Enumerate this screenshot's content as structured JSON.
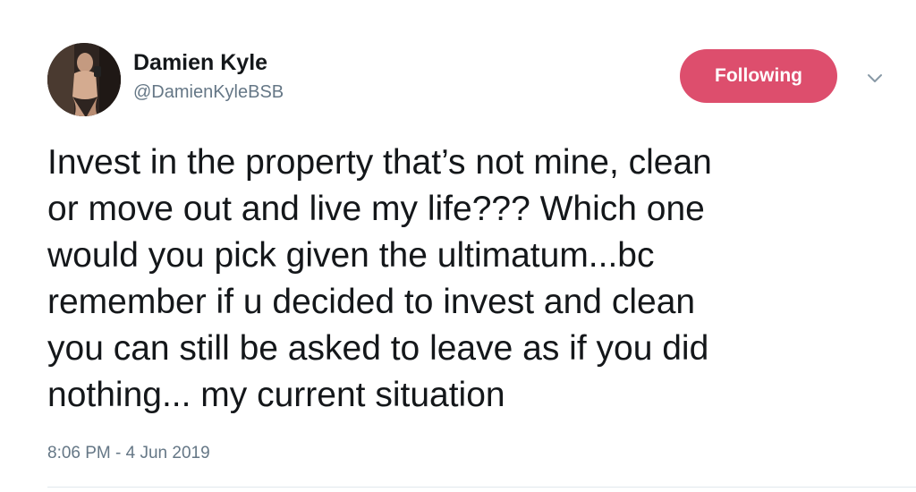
{
  "author": {
    "display_name": "Damien Kyle",
    "handle": "@DamienKyleBSB",
    "avatar_icon": "profile-photo"
  },
  "follow_button": {
    "label": "Following",
    "color": "#dd4e6d"
  },
  "menu": {
    "icon": "chevron-down-icon"
  },
  "tweet": {
    "lines": [
      "Invest in the property that’s not mine, clean",
      "or move out and live my life??? Which one",
      "would you pick given the ultimatum...bc",
      "remember if u decided to invest and clean",
      "you can still be asked to leave as if you did",
      "nothing... my current situation"
    ],
    "timestamp": "8:06 PM - 4 Jun 2019"
  },
  "colors": {
    "text_primary": "#14171a",
    "text_secondary": "#657786",
    "divider": "#e1e8ed"
  }
}
